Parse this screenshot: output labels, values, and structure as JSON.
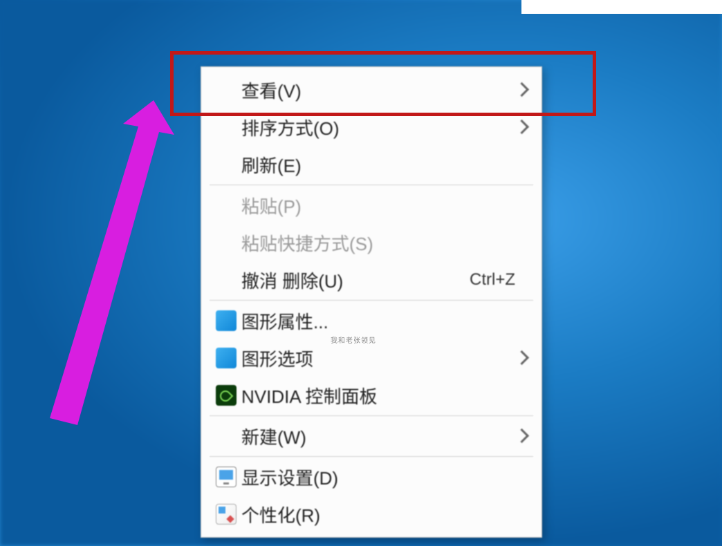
{
  "context_menu": {
    "items": [
      {
        "label": "查看(V)",
        "hasSubmenu": true
      },
      {
        "label": "排序方式(O)",
        "hasSubmenu": true
      },
      {
        "label": "刷新(E)"
      },
      {
        "separator": true
      },
      {
        "label": "粘贴(P)",
        "disabled": true
      },
      {
        "label": "粘贴快捷方式(S)",
        "disabled": true
      },
      {
        "label": "撤消 删除(U)",
        "shortcut": "Ctrl+Z"
      },
      {
        "separator": true
      },
      {
        "label": "图形属性...",
        "icon": "intel-blue"
      },
      {
        "label": "图形选项",
        "icon": "intel-blue",
        "hasSubmenu": true
      },
      {
        "label": "NVIDIA 控制面板",
        "icon": "nvidia"
      },
      {
        "separator": true
      },
      {
        "label": "新建(W)",
        "hasSubmenu": true
      },
      {
        "separator": true
      },
      {
        "label": "显示设置(D)",
        "icon": "display"
      },
      {
        "label": "个性化(R)",
        "icon": "personalize"
      }
    ]
  },
  "annotation": {
    "highlight_target": "查看(V)",
    "arrow_color": "#d81ee0"
  },
  "watermark_text": "我和老张领见"
}
